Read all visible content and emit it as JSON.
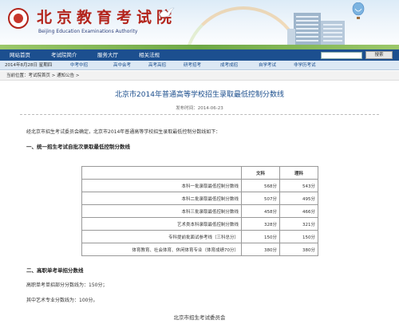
{
  "header": {
    "logo_cn": "北京教育考试院",
    "logo_en": "Beijing Education Examinations Authority"
  },
  "nav": {
    "items": [
      "网站首页",
      "考试院简介",
      "服务大厅",
      "相关法规"
    ],
    "search_button": "搜索"
  },
  "subnav": {
    "date": "2014年8月28日 星期四",
    "items": [
      "中考中招",
      "高中会考",
      "高考高招",
      "研考招考",
      "成考成招",
      "自学考试",
      "非学历考试"
    ]
  },
  "breadcrumb": {
    "text": "当前位置：考试院首页 > 通知公告 >"
  },
  "article": {
    "title": "北京市2014年普通高等学校招生录取最低控制分数线",
    "pubdate": "发布时间：2014-06-23",
    "intro": "经北京市招生考试委员会确定，北京市2014年普通高等学校招生录取最低控制分数线如下：",
    "section1": "一、统一招生考试自批次录取最低控制分数线",
    "section2": "二、高职单考单招分数线",
    "line1": "高职单考单招部分分数线为：150分；",
    "line2": "其中艺术专业分数线为：100分。",
    "signature": "北京市招生考试委员会"
  },
  "table": {
    "headers": [
      "",
      "文科",
      "理科"
    ],
    "rows": [
      [
        "本科一批录取最低控制分数线",
        "568分",
        "543分"
      ],
      [
        "本科二批录取最低控制分数线",
        "507分",
        "495分"
      ],
      [
        "本科三批录取最低控制分数线",
        "458分",
        "466分"
      ],
      [
        "艺术类本科录取最低控制分数线",
        "328分",
        "321分"
      ],
      [
        "专科提前批面试参考线（三科总分）",
        "150分",
        "150分"
      ],
      [
        "体育教育、社会体育、休闲体育专业（体育成绩70分）",
        "380分",
        "380分"
      ]
    ]
  }
}
